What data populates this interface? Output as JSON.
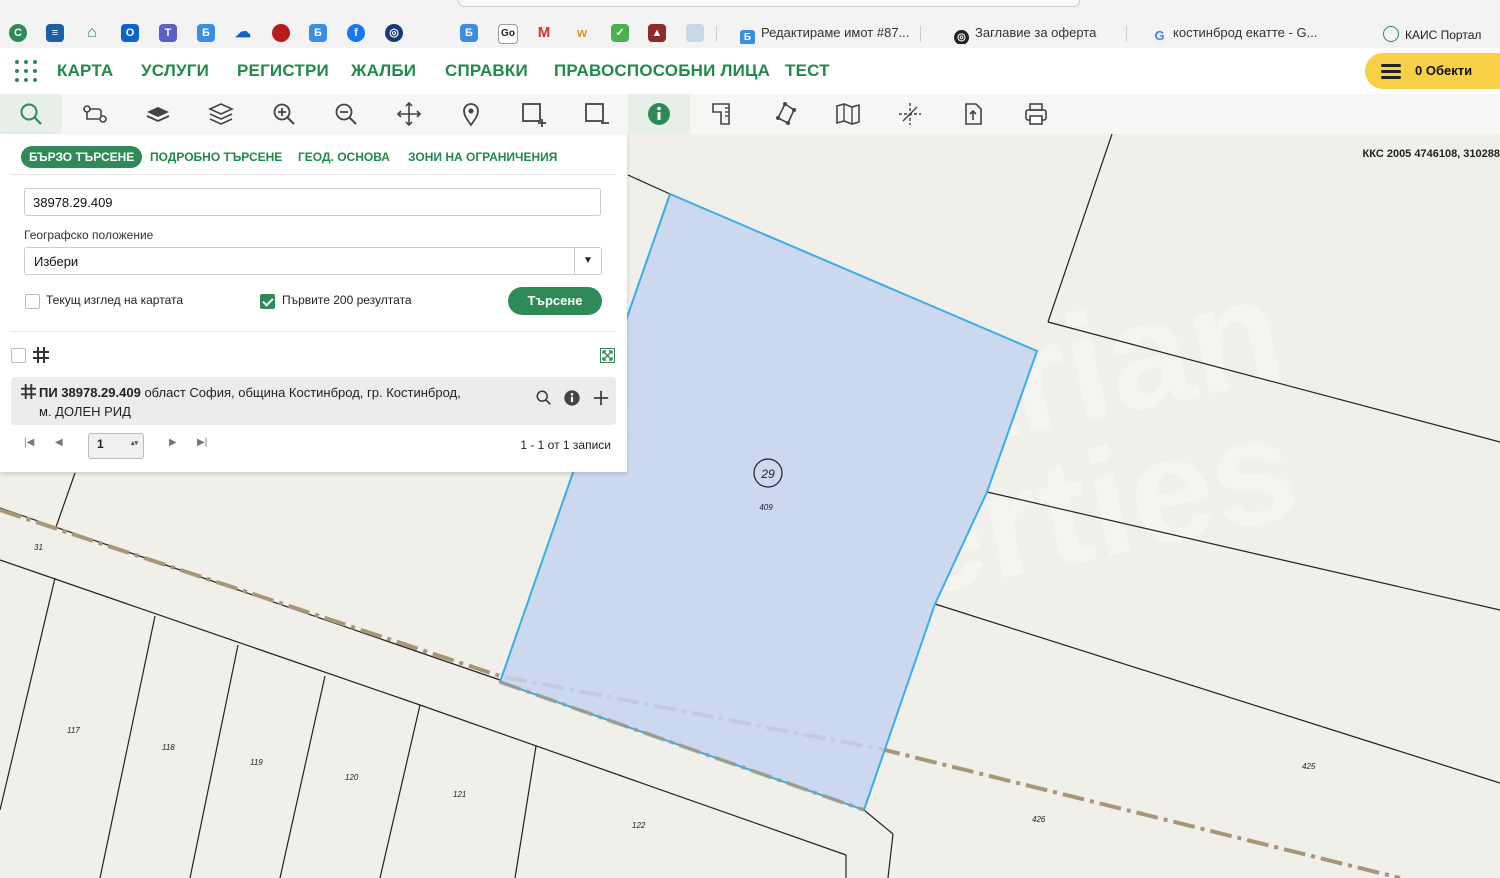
{
  "bookmarks": {
    "tabs": [
      {
        "label": "Редактираме имот #87..."
      },
      {
        "label": "Заглавие за оферта"
      },
      {
        "label": "костинброд екатте - G..."
      }
    ],
    "right_tab": "КАИС Портал"
  },
  "nav": {
    "items": [
      "КАРТА",
      "УСЛУГИ",
      "РЕГИСТРИ",
      "ЖАЛБИ",
      "СПРАВКИ",
      "ПРАВОСПОСОБНИ ЛИЦА",
      "ТЕСТ"
    ],
    "objects_label": "0 Обекти"
  },
  "toolbar": {
    "tools": [
      "search-icon",
      "route-icon",
      "layer-icon",
      "layers-icon",
      "zoom-in-icon",
      "zoom-out-icon",
      "pan-icon",
      "marker-icon",
      "select-area-add-icon",
      "select-area-remove-icon",
      "info-icon",
      "measure-icon",
      "polygon-icon",
      "map-icon",
      "crosshair-icon",
      "export-icon",
      "print-icon"
    ]
  },
  "map": {
    "coords": "ККС 2005 4746108, 310288",
    "parcel_circle_label": "29",
    "parcel_number": "409",
    "labels": [
      "31",
      "117",
      "118",
      "119",
      "120",
      "121",
      "122",
      "425",
      "426"
    ]
  },
  "panel": {
    "tabs": [
      "БЪРЗО ТЪРСЕНЕ",
      "ПОДРОБНО ТЪРСЕНЕ",
      "ГЕОД. ОСНОВА",
      "ЗОНИ НА ОГРАНИЧЕНИЯ"
    ],
    "search_value": "38978.29.409",
    "geo_label": "Географско положение",
    "geo_value": "Избери",
    "cb_current_view": "Текущ изглед на картата",
    "cb_first_200": "Първите 200 резултата",
    "cb_first_200_checked": true,
    "search_button": "Търсене",
    "result_id": "ПИ 38978.29.409",
    "result_desc": " област София, община Костинброд, гр. Костинброд,",
    "result_desc2": "м. ДОЛЕН РИД",
    "page": "1",
    "records": "1 - 1 от 1 записи"
  },
  "colors": {
    "brand_green": "#1f8a4c",
    "button_green": "#2e8b57",
    "objects_yellow": "#f7d046",
    "parcel_fill": "#c5d3f0",
    "parcel_stroke": "#3aaee6"
  }
}
